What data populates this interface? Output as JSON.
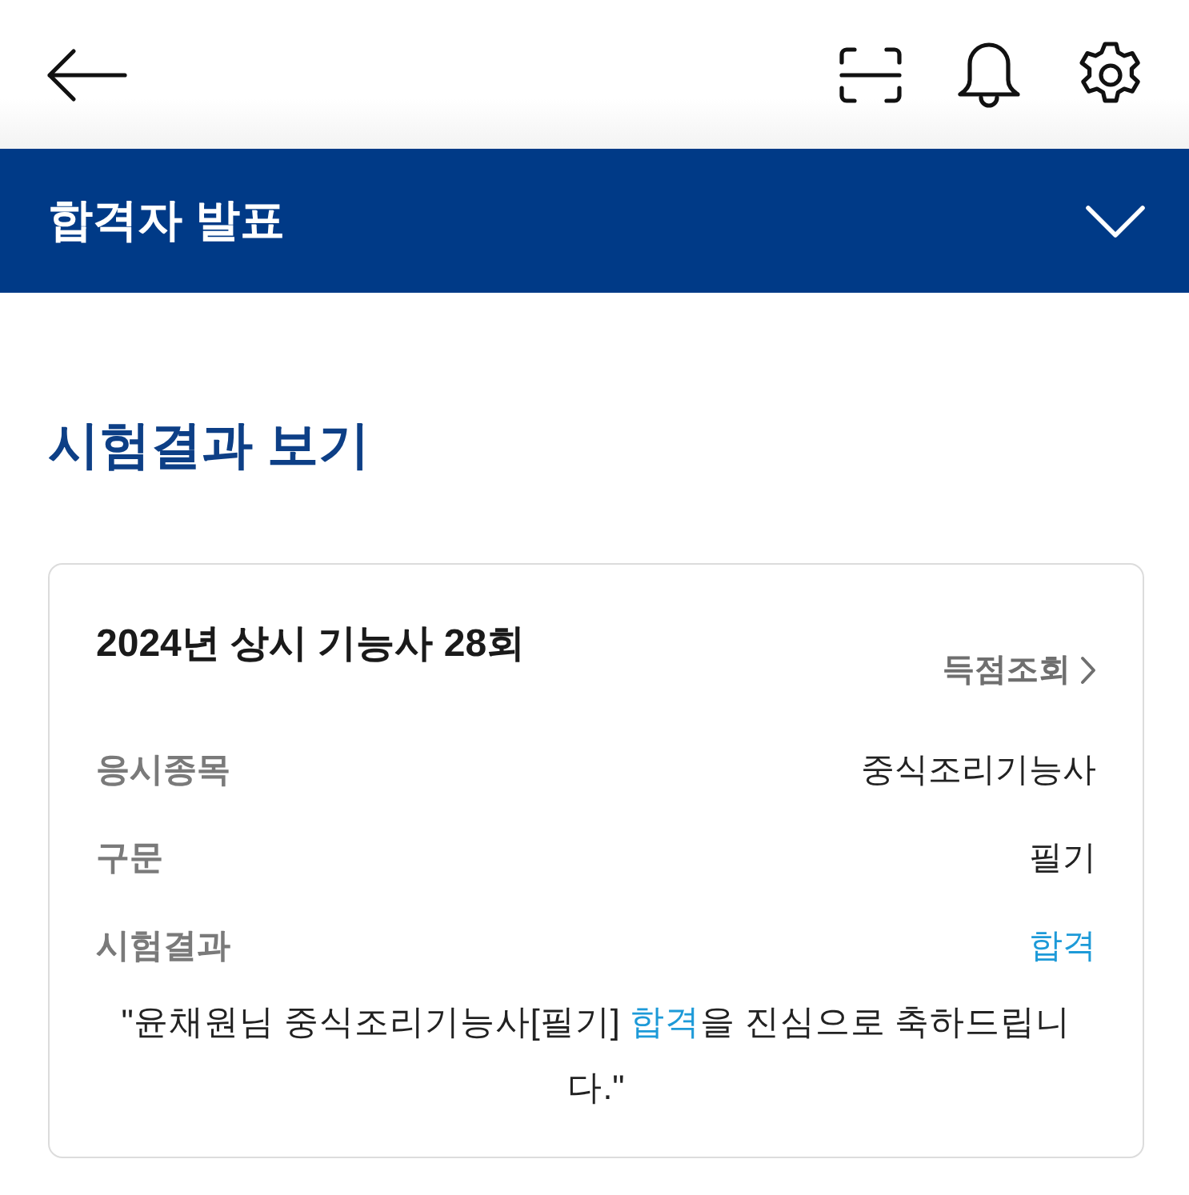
{
  "section_bar": {
    "title": "합격자 발표",
    "expanded": false
  },
  "heading": "시험결과 보기",
  "result_card": {
    "title": "2024년 상시 기능사 28회",
    "score_link": "득점조회",
    "rows": [
      {
        "label": "응시종목",
        "value": "중식조리기능사",
        "highlighted": false
      },
      {
        "label": "구문",
        "value": "필기",
        "highlighted": false
      },
      {
        "label": "시험결과",
        "value": "합격",
        "highlighted": true
      }
    ],
    "message": {
      "before": "\"윤채원님 중식조리기능사[필기] ",
      "highlight": "합격",
      "after": "을 진심으로 축하드립니다.\""
    }
  }
}
